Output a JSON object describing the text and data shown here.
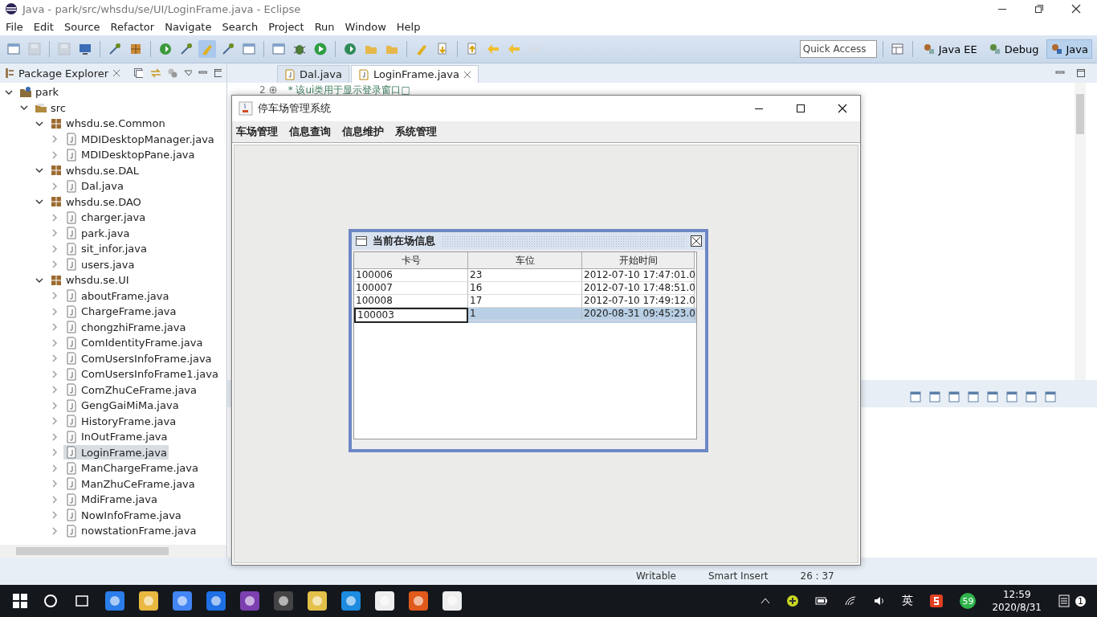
{
  "window": {
    "title": "Java - park/src/whsdu/se/UI/LoginFrame.java - Eclipse"
  },
  "menu": [
    "File",
    "Edit",
    "Source",
    "Refactor",
    "Navigate",
    "Search",
    "Project",
    "Run",
    "Window",
    "Help"
  ],
  "quick_access": {
    "placeholder": "Quick Access"
  },
  "perspectives": [
    {
      "label": "Java EE",
      "selected": false
    },
    {
      "label": "Debug",
      "selected": false
    },
    {
      "label": "Java",
      "selected": true
    }
  ],
  "package_explorer": {
    "title": "Package Explorer",
    "tree": [
      {
        "label": "park",
        "kind": "project",
        "expanded": true,
        "selected": false,
        "children": [
          {
            "label": "src",
            "kind": "folder",
            "expanded": true,
            "selected": false,
            "children": [
              {
                "label": "whsdu.se.Common",
                "kind": "package",
                "expanded": true,
                "selected": false,
                "children": [
                  {
                    "label": "MDIDesktopManager.java",
                    "kind": "file",
                    "expanded": false,
                    "selected": false
                  },
                  {
                    "label": "MDIDesktopPane.java",
                    "kind": "file",
                    "expanded": false,
                    "selected": false
                  }
                ]
              },
              {
                "label": "whsdu.se.DAL",
                "kind": "package",
                "expanded": true,
                "selected": false,
                "children": [
                  {
                    "label": "Dal.java",
                    "kind": "file",
                    "expanded": false,
                    "selected": false
                  }
                ]
              },
              {
                "label": "whsdu.se.DAO",
                "kind": "package",
                "expanded": true,
                "selected": false,
                "children": [
                  {
                    "label": "charger.java",
                    "kind": "file",
                    "expanded": false,
                    "selected": false
                  },
                  {
                    "label": "park.java",
                    "kind": "file",
                    "expanded": false,
                    "selected": false
                  },
                  {
                    "label": "sit_infor.java",
                    "kind": "file",
                    "expanded": false,
                    "selected": false
                  },
                  {
                    "label": "users.java",
                    "kind": "file",
                    "expanded": false,
                    "selected": false
                  }
                ]
              },
              {
                "label": "whsdu.se.UI",
                "kind": "package",
                "expanded": true,
                "selected": false,
                "children": [
                  {
                    "label": "aboutFrame.java",
                    "kind": "file",
                    "expanded": false,
                    "selected": false
                  },
                  {
                    "label": "ChargeFrame.java",
                    "kind": "file",
                    "expanded": false,
                    "selected": false
                  },
                  {
                    "label": "chongzhiFrame.java",
                    "kind": "file",
                    "expanded": false,
                    "selected": false
                  },
                  {
                    "label": "ComIdentityFrame.java",
                    "kind": "file",
                    "expanded": false,
                    "selected": false
                  },
                  {
                    "label": "ComUsersInfoFrame.java",
                    "kind": "file",
                    "expanded": false,
                    "selected": false
                  },
                  {
                    "label": "ComUsersInfoFrame1.java",
                    "kind": "file",
                    "expanded": false,
                    "selected": false
                  },
                  {
                    "label": "ComZhuCeFrame.java",
                    "kind": "file",
                    "expanded": false,
                    "selected": false
                  },
                  {
                    "label": "GengGaiMiMa.java",
                    "kind": "file",
                    "expanded": false,
                    "selected": false
                  },
                  {
                    "label": "HistoryFrame.java",
                    "kind": "file",
                    "expanded": false,
                    "selected": false
                  },
                  {
                    "label": "InOutFrame.java",
                    "kind": "file",
                    "expanded": false,
                    "selected": false
                  },
                  {
                    "label": "LoginFrame.java",
                    "kind": "file",
                    "expanded": false,
                    "selected": true
                  },
                  {
                    "label": "ManChargeFrame.java",
                    "kind": "file",
                    "expanded": false,
                    "selected": false
                  },
                  {
                    "label": "ManZhuCeFrame.java",
                    "kind": "file",
                    "expanded": false,
                    "selected": false
                  },
                  {
                    "label": "MdiFrame.java",
                    "kind": "file",
                    "expanded": false,
                    "selected": false
                  },
                  {
                    "label": "NowInfoFrame.java",
                    "kind": "file",
                    "expanded": false,
                    "selected": false
                  },
                  {
                    "label": "nowstationFrame.java",
                    "kind": "file",
                    "expanded": false,
                    "selected": false
                  }
                ]
              }
            ]
          }
        ]
      }
    ]
  },
  "editor": {
    "tabs": [
      {
        "label": "Dal.java",
        "selected": false
      },
      {
        "label": "LoginFrame.java",
        "selected": true
      }
    ],
    "code_lines": [
      {
        "number": "2",
        "text": "* 该ui类用于显示登录窗口□"
      }
    ]
  },
  "status_bar": [
    "Writable",
    "Smart Insert",
    "26 : 37"
  ],
  "app_window": {
    "title": "停车场管理系统",
    "menu": [
      "车场管理",
      "信息查询",
      "信息维护",
      "系统管理"
    ],
    "internal_frame": {
      "title": "当前在场信息",
      "columns": [
        "卡号",
        "车位",
        "开始时间"
      ],
      "rows": [
        {
          "cells": [
            "100006",
            "23",
            "2012-07-10 17:47:01.0"
          ],
          "selected": false
        },
        {
          "cells": [
            "100007",
            "16",
            "2012-07-10 17:48:51.0"
          ],
          "selected": false
        },
        {
          "cells": [
            "100008",
            "17",
            "2012-07-10 17:49:12.0"
          ],
          "selected": false
        },
        {
          "cells": [
            "100003",
            "1",
            "2020-08-31 09:45:23.0"
          ],
          "selected": true
        }
      ]
    }
  },
  "taskbar": {
    "ime": "英",
    "badge": "59",
    "time": "12:59",
    "date": "2020/8/31",
    "notifications": "1"
  }
}
